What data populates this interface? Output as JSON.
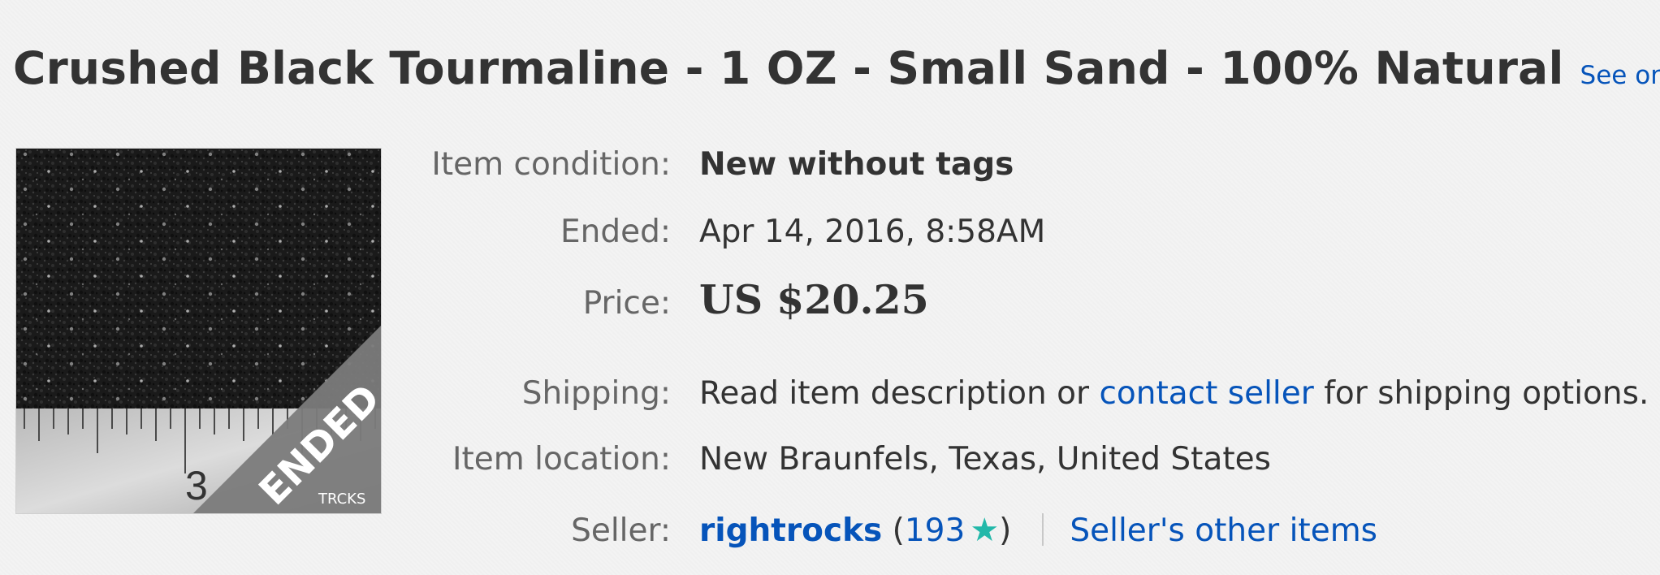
{
  "listing": {
    "title": "Crushed Black Tourmaline - 1 OZ - Small Sand - 100% Natural",
    "see_original": "See original listing"
  },
  "thumbnail": {
    "banner_text": "ENDED",
    "ruler_number": "3",
    "watermark": "TRCKS"
  },
  "details": {
    "condition": {
      "label": "Item condition:",
      "value": "New without tags"
    },
    "ended": {
      "label": "Ended:",
      "value": "Apr 14, 2016, 8:58AM"
    },
    "price": {
      "label": "Price:",
      "value": "US $20.25"
    },
    "shipping": {
      "label": "Shipping:",
      "text_before": "Read item description or ",
      "link": "contact seller",
      "text_after": " for shipping options."
    },
    "location": {
      "label": "Item location:",
      "value": "New Braunfels, Texas, United States"
    },
    "seller": {
      "label": "Seller:",
      "name": "rightrocks",
      "paren_open": "(",
      "feedback_score": "193",
      "paren_close": ")",
      "other_items": "Seller's other items"
    }
  },
  "colors": {
    "link": "#0654ba",
    "star": "#22b8a9",
    "text": "#333333",
    "label": "#666666"
  }
}
